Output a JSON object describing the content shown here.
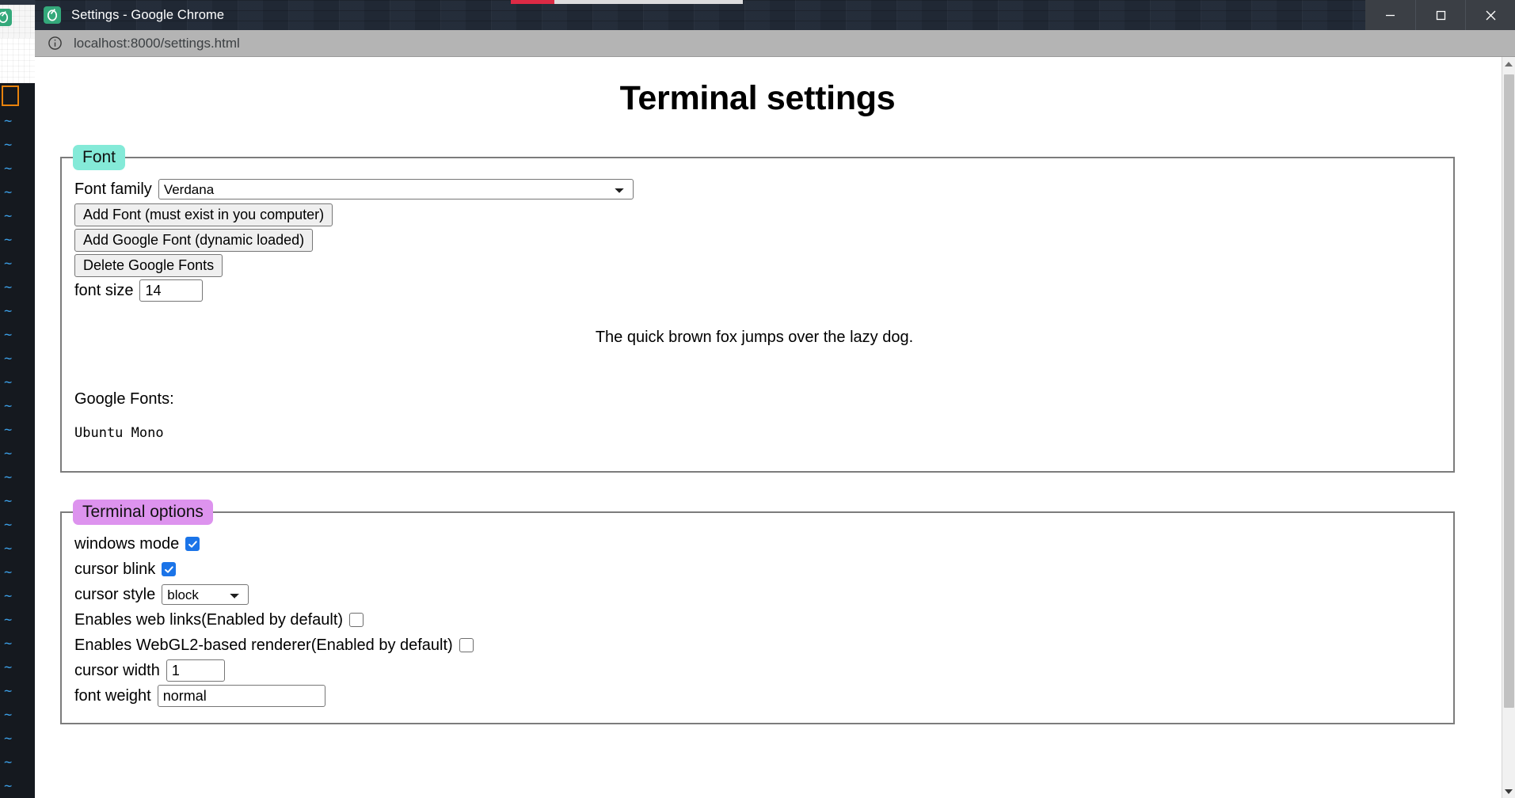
{
  "window": {
    "title": "Settings - Google Chrome",
    "favicon_name": "terminal-app-favicon",
    "controls": {
      "minimize": "—",
      "maximize": "☐",
      "close": "✕"
    }
  },
  "addressbar": {
    "info_icon": "site-info-icon",
    "url": "localhost:8000/settings.html"
  },
  "page": {
    "title": "Terminal settings"
  },
  "font_section": {
    "legend": "Font",
    "legend_color": "#84ead8",
    "font_family_label": "Font family",
    "font_family_value": "Verdana",
    "font_family_options": [
      "Verdana"
    ],
    "buttons": [
      "Add Font (must exist in you computer)",
      "Add Google Font (dynamic loaded)",
      "Delete Google Fonts"
    ],
    "font_size_label": "font size",
    "font_size_value": "14",
    "preview_text": "The quick brown fox jumps over the lazy dog.",
    "google_fonts_label": "Google Fonts:",
    "google_fonts_items": [
      "Ubuntu Mono"
    ]
  },
  "terminal_section": {
    "legend": "Terminal options",
    "legend_color": "#dd93ee",
    "windows_mode_label": "windows mode",
    "windows_mode_checked": true,
    "cursor_blink_label": "cursor blink",
    "cursor_blink_checked": true,
    "cursor_style_label": "cursor style",
    "cursor_style_value": "block",
    "cursor_style_options": [
      "block"
    ],
    "web_links_label": "Enables web links(Enabled by default)",
    "web_links_checked": false,
    "webgl2_label": "Enables WebGL2-based renderer(Enabled by default)",
    "webgl2_checked": false,
    "cursor_width_label": "cursor width",
    "cursor_width_value": "1",
    "font_weight_label": "font weight",
    "font_weight_value": "normal"
  },
  "background": {
    "terminal_tilde": "~",
    "terminal_tilde_color": "#3b9ee5",
    "cursor_color": "#e8820c"
  }
}
